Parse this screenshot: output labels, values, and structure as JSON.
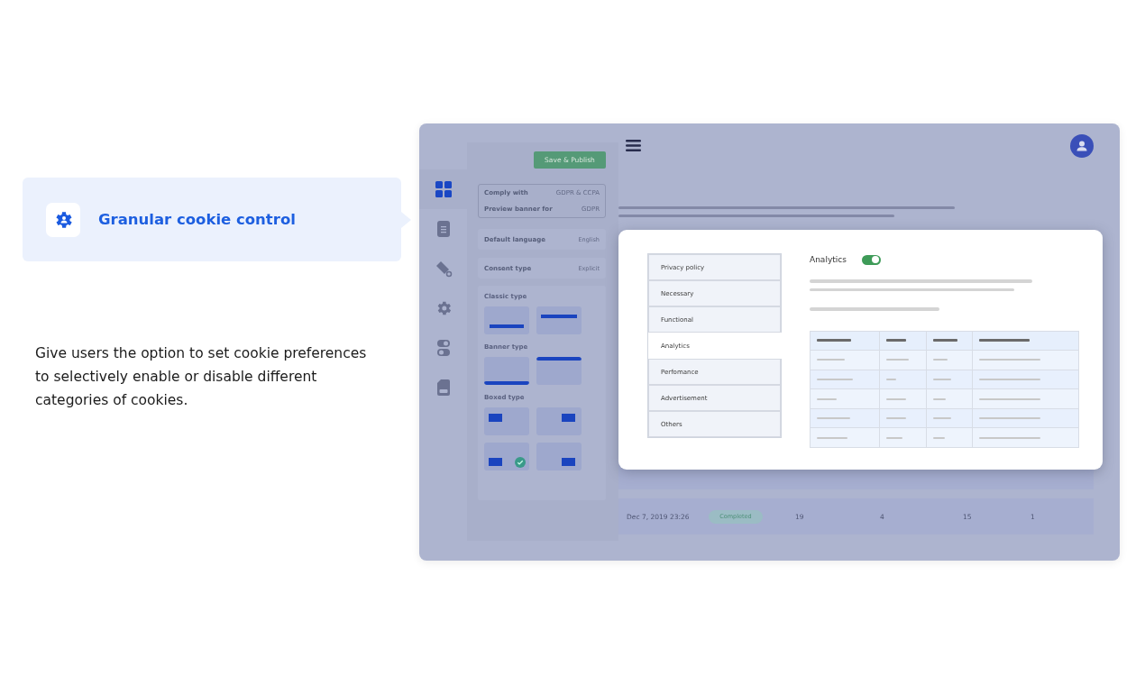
{
  "feature": {
    "title": "Granular cookie control",
    "description": "Give users the option to set cookie preferences to selectively enable or disable different categories of cookies."
  },
  "app": {
    "rail": [
      {
        "kind": "grid",
        "selected": true
      },
      {
        "kind": "document",
        "selected": false
      },
      {
        "kind": "tag",
        "selected": false
      },
      {
        "kind": "gear",
        "selected": false
      },
      {
        "kind": "toggles",
        "selected": false
      },
      {
        "kind": "css-file",
        "selected": false
      }
    ],
    "save_button": "Save & Publish",
    "settings": [
      {
        "label": "Comply with",
        "value": "GDPR & CCPA"
      },
      {
        "label": "Preview banner for",
        "value": "GDPR"
      }
    ],
    "fields": [
      {
        "label": "Default language",
        "value": "English"
      },
      {
        "label": "Consent type",
        "value": "Explicit"
      }
    ],
    "layout_groups": [
      {
        "title": "Classic type",
        "options": [
          {
            "kind": "bottom-bar",
            "selected": false
          },
          {
            "kind": "top-bar",
            "selected": false
          }
        ]
      },
      {
        "title": "Banner type",
        "options": [
          {
            "kind": "bottom-edge",
            "selected": false
          },
          {
            "kind": "top-edge",
            "selected": false
          }
        ]
      },
      {
        "title": "Boxed type",
        "options": [
          {
            "kind": "top-left",
            "selected": false
          },
          {
            "kind": "top-right",
            "selected": false
          },
          {
            "kind": "bottom-left",
            "selected": true
          },
          {
            "kind": "bottom-right",
            "selected": false
          }
        ]
      }
    ],
    "rows": [
      {
        "date": "Dec 7, 2019 23:26",
        "status": "Completed",
        "column_3": "19",
        "column_4": "4",
        "column_5": "15",
        "column_6": "1"
      }
    ],
    "modal": {
      "categories": [
        {
          "label": "Privacy policy",
          "selected": false
        },
        {
          "label": "Necessary",
          "selected": false
        },
        {
          "label": "Functional",
          "selected": false
        },
        {
          "label": "Analytics",
          "selected": true
        },
        {
          "label": "Perfomance",
          "selected": false
        },
        {
          "label": "Advertisement",
          "selected": false
        },
        {
          "label": "Others",
          "selected": false
        }
      ],
      "heading": "Analytics",
      "toggle_on": true
    }
  }
}
